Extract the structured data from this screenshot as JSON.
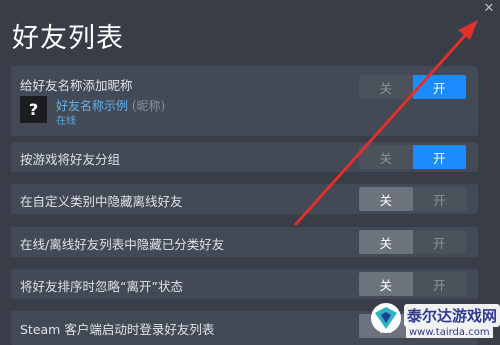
{
  "window": {
    "title": "好友列表",
    "close_icon": "close-icon"
  },
  "options": {
    "toggle_off": "关",
    "toggle_on": "开"
  },
  "settings": [
    {
      "label": "给好友名称添加昵称",
      "state": "on"
    },
    {
      "label": "按游戏将好友分组",
      "state": "on"
    },
    {
      "label": "在自定义类别中隐藏离线好友",
      "state": "off"
    },
    {
      "label": "在线/离线好友列表中隐藏已分类好友",
      "state": "off"
    },
    {
      "label": "将好友排序时忽略“离开”状态",
      "state": "off"
    },
    {
      "label": "Steam 客户端启动时登录好友列表",
      "state": "off"
    }
  ],
  "example": {
    "avatar": "?",
    "name": "好友名称示例",
    "nickname": "(昵称)",
    "status": "在线"
  },
  "colors": {
    "accent": "#1a8cff",
    "background": "#383d47",
    "row": "#444a55",
    "annotation_arrow": "#e0302a"
  },
  "watermark": {
    "text": "泰尔达游戏网",
    "url": "www.tairda.com"
  }
}
